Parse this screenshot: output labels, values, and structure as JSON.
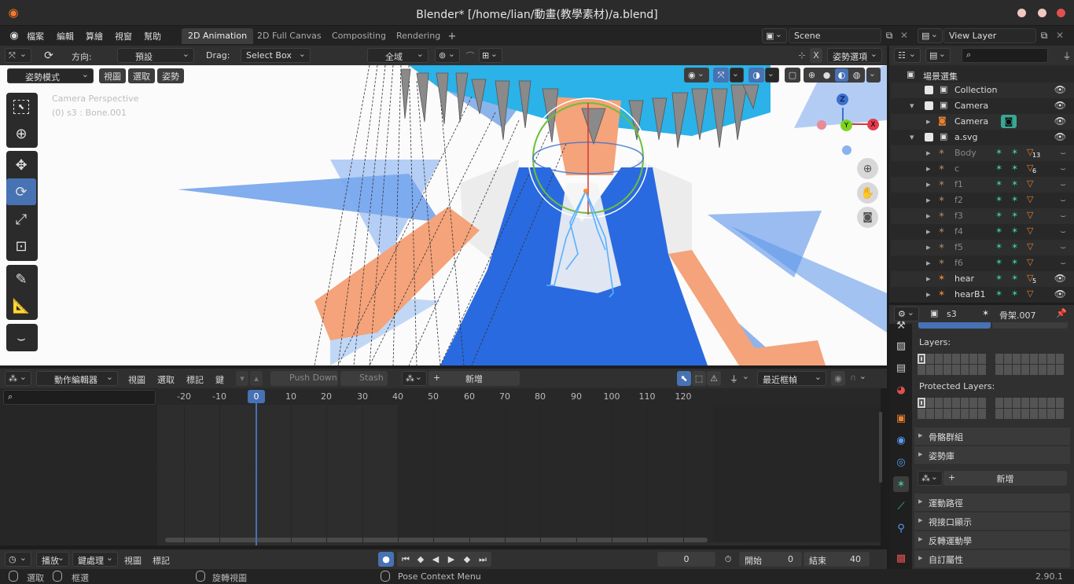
{
  "window": {
    "title": "Blender* [/home/lian/動畫(教學素材)/a.blend]"
  },
  "menu": [
    "檔案",
    "編輯",
    "算繪",
    "視窗",
    "幫助"
  ],
  "workspaces": [
    "2D Animation",
    "2D Full Canvas",
    "Compositing",
    "Rendering"
  ],
  "scene": {
    "label": "Scene"
  },
  "view_layer": {
    "label": "View Layer"
  },
  "viewport_header": {
    "orientation_label": "方向:",
    "orientation_value": "預設",
    "drag_label": "Drag:",
    "drag_value": "Select Box",
    "transform_space": "全域",
    "pose_options": "姿勢選項",
    "mode": "姿勢模式",
    "view": "視圖",
    "select": "選取",
    "pose": "姿勢"
  },
  "viewport_overlay": {
    "line1": "Camera Perspective",
    "line2": "(0) s3 : Bone.001"
  },
  "gizmo": {
    "z": "Z",
    "y": "Y",
    "x": "X"
  },
  "outliner": {
    "root": "場景選集",
    "rows": [
      {
        "name": "Collection"
      },
      {
        "name": "Camera"
      },
      {
        "name": "Camera"
      },
      {
        "name": "a.svg"
      },
      {
        "name": "Body",
        "badge": "13"
      },
      {
        "name": "c",
        "badge": "6"
      },
      {
        "name": "f1"
      },
      {
        "name": "f2"
      },
      {
        "name": "f3"
      },
      {
        "name": "f4"
      },
      {
        "name": "f5"
      },
      {
        "name": "f6"
      },
      {
        "name": "hear",
        "badge": "5"
      },
      {
        "name": "hearB1"
      }
    ]
  },
  "properties": {
    "object": "s3",
    "armature": "骨架.007",
    "layers_label": "Layers:",
    "protected_label": "Protected Layers:",
    "bone_groups": "骨骼群組",
    "pose_library": "姿勢庫",
    "new": "新增",
    "motion_paths": "運動路徑",
    "viewport_display": "視接口顯示",
    "ik": "反轉運動學",
    "custom_props": "自訂屬性"
  },
  "action_editor": {
    "mode": "動作編輯器",
    "view": "視圖",
    "select": "選取",
    "marker": "標記",
    "key": "鍵",
    "push_down": "Push Down",
    "stash": "Stash",
    "new": "新增",
    "filter": "最近框幀",
    "current_frame": "0",
    "ticks": [
      "-20",
      "-10",
      "0",
      "10",
      "20",
      "30",
      "40",
      "50",
      "60",
      "70",
      "80",
      "90",
      "100",
      "110",
      "120"
    ]
  },
  "timeline": {
    "playback": "播放",
    "keying": "鍵處理",
    "view": "視圖",
    "marker": "標記",
    "frame": "0",
    "start_label": "開始",
    "start": "0",
    "end_label": "結束",
    "end": "40"
  },
  "statusbar": {
    "select": "選取",
    "box": "框選",
    "rotate": "旋轉視圖",
    "context": "Pose Context Menu",
    "version": "2.90.1"
  },
  "colors": {
    "accent": "#4772b3",
    "bone_orange": "#e8812f",
    "dress_blue": "#2a6ae0"
  }
}
